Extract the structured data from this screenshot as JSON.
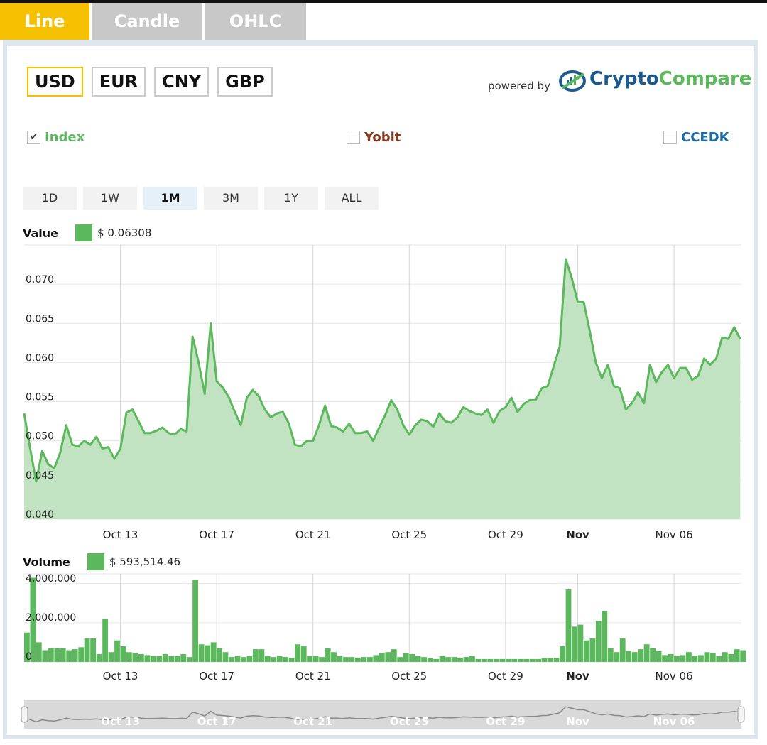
{
  "tabs": [
    {
      "label": "Line",
      "active": true
    },
    {
      "label": "Candle",
      "active": false
    },
    {
      "label": "OHLC",
      "active": false
    }
  ],
  "currencies": [
    {
      "label": "USD",
      "active": true
    },
    {
      "label": "EUR",
      "active": false
    },
    {
      "label": "CNY",
      "active": false
    },
    {
      "label": "GBP",
      "active": false
    }
  ],
  "powered_by": "powered by",
  "brand": {
    "part1": "Crypto",
    "part2": "Compare",
    "color1": "#1c5a8f",
    "color2": "#5cb85c"
  },
  "exchanges": [
    {
      "label": "Index",
      "checked": true,
      "color": "#5cb85c"
    },
    {
      "label": "Yobit",
      "checked": false,
      "color": "#8b3a1e"
    },
    {
      "label": "CCEDK",
      "checked": false,
      "color": "#1a6ea8"
    }
  ],
  "ranges": [
    {
      "label": "1D",
      "active": false
    },
    {
      "label": "1W",
      "active": false
    },
    {
      "label": "1M",
      "active": true
    },
    {
      "label": "3M",
      "active": false
    },
    {
      "label": "1Y",
      "active": false
    },
    {
      "label": "ALL",
      "active": false
    }
  ],
  "legend": {
    "value_label": "Value",
    "value": "$ 0.06308",
    "volume_label": "Volume",
    "volume": "$ 593,514.46"
  },
  "chart_data": [
    {
      "type": "area",
      "ylabel": "Value",
      "ylim": [
        0.04,
        0.075
      ],
      "yticks": [
        "0.040",
        "0.045",
        "0.050",
        "0.055",
        "0.060",
        "0.065",
        "0.070"
      ],
      "xlim": [
        0,
        29.8
      ],
      "xticks": [
        {
          "x": 4,
          "label": "Oct 13",
          "bold": false
        },
        {
          "x": 8,
          "label": "Oct 17",
          "bold": false
        },
        {
          "x": 12,
          "label": "Oct 21",
          "bold": false
        },
        {
          "x": 16,
          "label": "Oct 25",
          "bold": false
        },
        {
          "x": 20,
          "label": "Oct 29",
          "bold": false
        },
        {
          "x": 23,
          "label": "Nov",
          "bold": true
        },
        {
          "x": 27,
          "label": "Nov 06",
          "bold": false
        }
      ],
      "color": "#5cb85c",
      "fill": "#c1e3c1",
      "series": [
        {
          "x": [
            0,
            0.25,
            0.5,
            0.75,
            1.0,
            1.25,
            1.5,
            1.75,
            2.0,
            2.25,
            2.5,
            2.75,
            3.0,
            3.25,
            3.5,
            3.75,
            4.0,
            4.25,
            4.5,
            4.75,
            5.0,
            5.25,
            5.5,
            5.75,
            6.0,
            6.25,
            6.5,
            6.75,
            7.0,
            7.25,
            7.5,
            7.75,
            8.0,
            8.25,
            8.5,
            8.75,
            9.0,
            9.25,
            9.5,
            9.75,
            10.0,
            10.25,
            10.5,
            10.75,
            11.0,
            11.25,
            11.5,
            11.75,
            12.0,
            12.25,
            12.5,
            12.75,
            13.0,
            13.25,
            13.5,
            13.75,
            14.0,
            14.25,
            14.5,
            14.75,
            15.0,
            15.25,
            15.5,
            15.75,
            16.0,
            16.25,
            16.5,
            16.75,
            17.0,
            17.25,
            17.5,
            17.75,
            18.0,
            18.25,
            18.5,
            18.75,
            19.0,
            19.25,
            19.5,
            19.75,
            20.0,
            20.25,
            20.5,
            20.75,
            21.0,
            21.25,
            21.5,
            21.75,
            22.0,
            22.25,
            22.5,
            22.75,
            23.0,
            23.25,
            23.5,
            23.75,
            24.0,
            24.25,
            24.5,
            24.75,
            25.0,
            25.25,
            25.5,
            25.75,
            26.0,
            26.25,
            26.5,
            26.75,
            27.0,
            27.25,
            27.5,
            27.75,
            28.0,
            28.25,
            28.5,
            28.75,
            29.0,
            29.25,
            29.5,
            29.75
          ],
          "y": [
            0.0535,
            0.049,
            0.0448,
            0.0487,
            0.047,
            0.0465,
            0.0485,
            0.052,
            0.0495,
            0.0493,
            0.05,
            0.0495,
            0.0505,
            0.049,
            0.0492,
            0.0477,
            0.049,
            0.0536,
            0.054,
            0.0525,
            0.051,
            0.051,
            0.0513,
            0.0517,
            0.051,
            0.0508,
            0.0515,
            0.0512,
            0.0633,
            0.06,
            0.056,
            0.065,
            0.0576,
            0.0568,
            0.0556,
            0.0537,
            0.052,
            0.0555,
            0.0565,
            0.0557,
            0.054,
            0.053,
            0.0535,
            0.0537,
            0.0522,
            0.0495,
            0.0493,
            0.05,
            0.05,
            0.052,
            0.0545,
            0.0519,
            0.0517,
            0.0512,
            0.0522,
            0.051,
            0.051,
            0.0512,
            0.05,
            0.0517,
            0.0533,
            0.0552,
            0.054,
            0.052,
            0.0508,
            0.052,
            0.0527,
            0.0525,
            0.0518,
            0.0535,
            0.0525,
            0.0523,
            0.053,
            0.0543,
            0.0538,
            0.0535,
            0.0533,
            0.054,
            0.0523,
            0.0538,
            0.0543,
            0.0555,
            0.0537,
            0.0547,
            0.0552,
            0.0552,
            0.0567,
            0.057,
            0.0595,
            0.062,
            0.0732,
            0.0708,
            0.0677,
            0.0677,
            0.064,
            0.06,
            0.058,
            0.0597,
            0.057,
            0.0567,
            0.054,
            0.0548,
            0.0562,
            0.0548,
            0.0597,
            0.0575,
            0.0588,
            0.0597,
            0.058,
            0.0593,
            0.0593,
            0.0578,
            0.0583,
            0.0605,
            0.0597,
            0.0605,
            0.0632,
            0.063,
            0.0645,
            0.063
          ]
        }
      ]
    },
    {
      "type": "bar",
      "ylabel": "Volume",
      "ylim": [
        0,
        4500000
      ],
      "yticks": [
        "0",
        "2,000,000",
        "4,000,000"
      ],
      "xlim": [
        0,
        29.8
      ],
      "xticks": [
        {
          "x": 4,
          "label": "Oct 13",
          "bold": false
        },
        {
          "x": 8,
          "label": "Oct 17",
          "bold": false
        },
        {
          "x": 12,
          "label": "Oct 21",
          "bold": false
        },
        {
          "x": 16,
          "label": "Oct 25",
          "bold": false
        },
        {
          "x": 20,
          "label": "Oct 29",
          "bold": false
        },
        {
          "x": 23,
          "label": "Nov",
          "bold": true
        },
        {
          "x": 27,
          "label": "Nov 06",
          "bold": false
        }
      ],
      "color": "#5cb85c",
      "series": [
        {
          "x": [
            0,
            0.25,
            0.5,
            0.75,
            1.0,
            1.25,
            1.5,
            1.75,
            2.0,
            2.25,
            2.5,
            2.75,
            3.0,
            3.25,
            3.5,
            3.75,
            4.0,
            4.25,
            4.5,
            4.75,
            5.0,
            5.25,
            5.5,
            5.75,
            6.0,
            6.25,
            6.5,
            6.75,
            7.0,
            7.25,
            7.5,
            7.75,
            8.0,
            8.25,
            8.5,
            8.75,
            9.0,
            9.25,
            9.5,
            9.75,
            10.0,
            10.25,
            10.5,
            10.75,
            11.0,
            11.25,
            11.5,
            11.75,
            12.0,
            12.25,
            12.5,
            12.75,
            13.0,
            13.25,
            13.5,
            13.75,
            14.0,
            14.25,
            14.5,
            14.75,
            15.0,
            15.25,
            15.5,
            15.75,
            16.0,
            16.25,
            16.5,
            16.75,
            17.0,
            17.25,
            17.5,
            17.75,
            18.0,
            18.25,
            18.5,
            18.75,
            19.0,
            19.25,
            19.5,
            19.75,
            20.0,
            20.25,
            20.5,
            20.75,
            21.0,
            21.25,
            21.5,
            21.75,
            22.0,
            22.25,
            22.5,
            22.75,
            23.0,
            23.25,
            23.5,
            23.75,
            24.0,
            24.25,
            24.5,
            24.75,
            25.0,
            25.25,
            25.5,
            25.75,
            26.0,
            26.25,
            26.5,
            26.75,
            27.0,
            27.25,
            27.5,
            27.75,
            28.0,
            28.25,
            28.5,
            28.75,
            29.0,
            29.25,
            29.5,
            29.75
          ],
          "y": [
            1500000,
            4300000,
            1000000,
            600000,
            700000,
            700000,
            700000,
            600000,
            650000,
            750000,
            1200000,
            1200000,
            400000,
            2200000,
            500000,
            1100000,
            800000,
            500000,
            450000,
            400000,
            350000,
            300000,
            300000,
            400000,
            300000,
            300000,
            400000,
            250000,
            4200000,
            900000,
            850000,
            1000000,
            700000,
            500000,
            250000,
            300000,
            250000,
            300000,
            650000,
            650000,
            300000,
            250000,
            300000,
            250000,
            200000,
            900000,
            800000,
            300000,
            300000,
            250000,
            700000,
            500000,
            300000,
            250000,
            250000,
            200000,
            250000,
            250000,
            350000,
            450000,
            500000,
            650000,
            250000,
            450000,
            400000,
            300000,
            250000,
            200000,
            150000,
            300000,
            250000,
            250000,
            200000,
            250000,
            300000,
            150000,
            150000,
            150000,
            150000,
            150000,
            150000,
            150000,
            150000,
            150000,
            150000,
            150000,
            200000,
            200000,
            200000,
            800000,
            3700000,
            1800000,
            1900000,
            1100000,
            1200000,
            2100000,
            2600000,
            700000,
            500000,
            1200000,
            550000,
            500000,
            650000,
            900000,
            700000,
            550000,
            350000,
            400000,
            300000,
            350000,
            500000,
            300000,
            350000,
            500000,
            450000,
            300000,
            500000,
            400000,
            650000,
            600000
          ]
        }
      ]
    }
  ],
  "navigator_labels": [
    "Oct 13",
    "Oct 17",
    "Oct 21",
    "Oct 25",
    "Oct 29",
    "Nov",
    "Nov 06"
  ]
}
